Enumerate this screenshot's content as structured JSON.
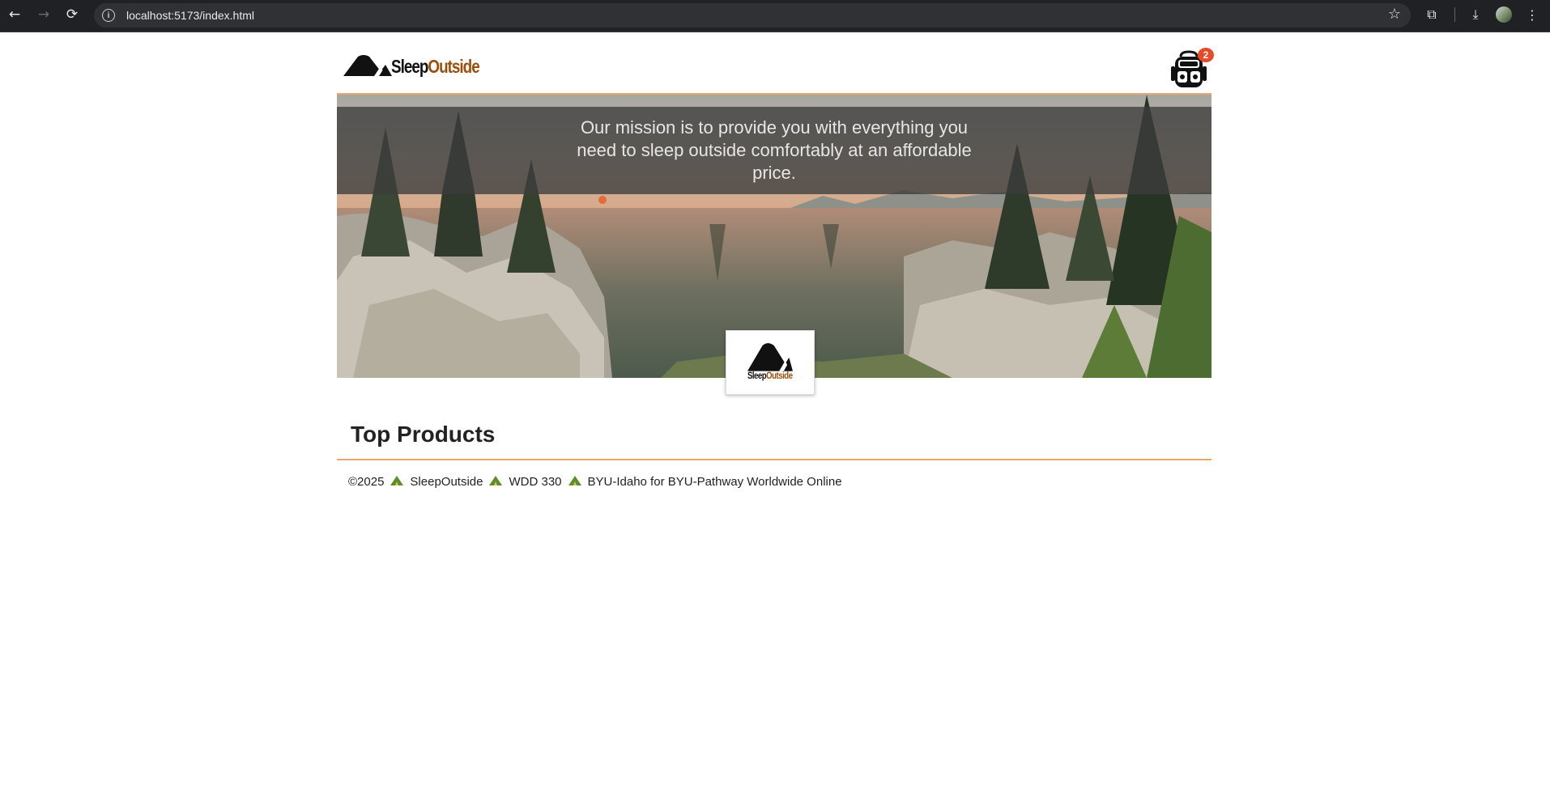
{
  "browser": {
    "url": "localhost:5173/index.html",
    "back_icon": "←",
    "forward_icon": "→",
    "reload_icon": "⟳",
    "star_icon": "☆",
    "extensions_icon": "⧉",
    "download_icon": "⤓",
    "menu_icon": "⋮"
  },
  "header": {
    "logo_sleep": "Sleep",
    "logo_outside": "Outside",
    "cart_count": "2"
  },
  "hero": {
    "mission": "Our mission is to provide you with everything you need to sleep outside comfortably at an affordable price.",
    "logo_sleep": "Sleep",
    "logo_outside": "Outside"
  },
  "main": {
    "section_title": "Top Products"
  },
  "footer": {
    "copyright": "©2025",
    "brand": "SleepOutside",
    "course": "WDD 330",
    "school": "BYU-Idaho for BYU-Pathway Worldwide Online"
  },
  "colors": {
    "accent_border": "#e8a86b",
    "logo_outside": "#9c4f0d",
    "badge": "#e84a27"
  }
}
